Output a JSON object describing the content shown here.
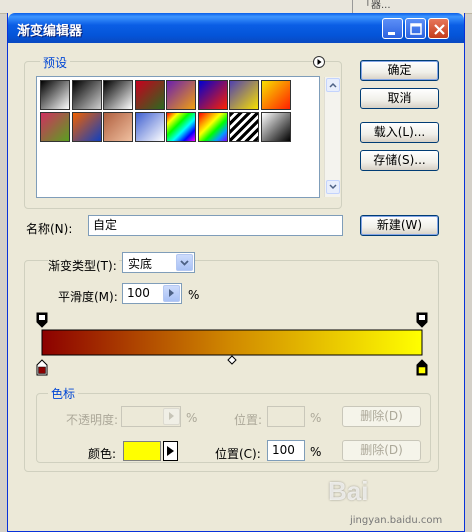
{
  "window": {
    "title": "渐变编辑器",
    "desktop_snippet": "「器...",
    "accent": "#0454d8"
  },
  "presets": {
    "label": "预设",
    "swatches": [
      [
        "#000000",
        "#ffffff"
      ],
      [
        "#000000",
        "#d0d0d0"
      ],
      [
        "#000000",
        "#ffffff"
      ],
      [
        "#c8001e",
        "#2a6b1f"
      ],
      [
        "#6a1fb0",
        "#f0a010"
      ],
      [
        "#0000d0",
        "#ff2000"
      ],
      [
        "#5040b0",
        "#f8e000"
      ],
      [
        "#f8e000",
        "#ff2000"
      ],
      [
        "#d03060",
        "#5aa020"
      ],
      [
        "#f06000",
        "#1040c0"
      ],
      [
        "#b06040",
        "#f0c0a0"
      ],
      [
        "#4060d0",
        "#ffffff"
      ],
      [
        "#ff0000",
        "#00b0ff"
      ],
      [
        "#ff0000",
        "#00ff00"
      ],
      [
        "#000000",
        "#ffffff"
      ],
      [
        "#ffffff",
        "#000000"
      ]
    ]
  },
  "buttons": {
    "ok": "确定",
    "cancel": "取消",
    "load": "载入(L)...",
    "save": "存储(S)...",
    "new": "新建(W)"
  },
  "name": {
    "label": "名称(N):",
    "value": "自定"
  },
  "gradient": {
    "type_label": "渐变类型(T):",
    "type_value": "实底",
    "smooth_label": "平滑度(M):",
    "smooth_value": "100",
    "smooth_unit": "%",
    "start_color": "#8c0000",
    "mid_color": "#d18a00",
    "end_color": "#ffff00"
  },
  "stops": {
    "label": "色标",
    "opacity_label": "不透明度:",
    "opacity_unit": "%",
    "opacity_pos_label": "位置:",
    "opacity_pos_unit": "%",
    "delete1": "删除(D)",
    "color_label": "颜色:",
    "color_value": "#ffff00",
    "color_pos_label": "位置(C):",
    "color_pos_value": "100",
    "color_pos_unit": "%",
    "delete2": "删除(D)"
  },
  "watermark": {
    "brand": "Bai",
    "site": "jingyan.baidu.com"
  }
}
